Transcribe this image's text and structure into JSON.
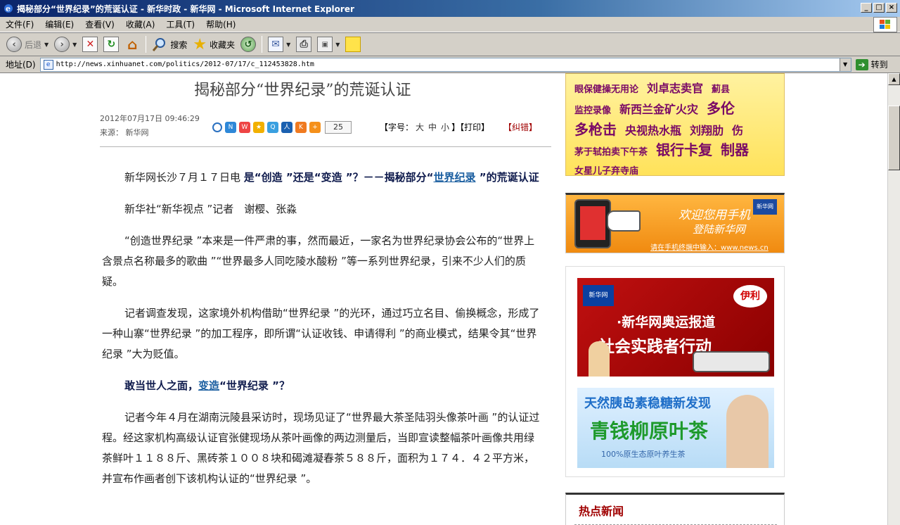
{
  "window": {
    "title": "揭秘部分“世界纪录”的荒诞认证 - 新华时政 - 新华网 - Microsoft Internet Explorer"
  },
  "menu": [
    "文件(F)",
    "编辑(E)",
    "查看(V)",
    "收藏(A)",
    "工具(T)",
    "帮助(H)"
  ],
  "toolbar": {
    "back_label": "后退",
    "search_label": "搜索",
    "favorites_label": "收藏夹"
  },
  "address": {
    "label": "地址(D)",
    "url": "http://news.xinhuanet.com/politics/2012-07/17/c_112453828.htm",
    "go_label": "转到"
  },
  "article": {
    "title": "揭秘部分“世界纪录”的荒诞认证",
    "date": "2012年07月17日 09:46:29",
    "source": "来源： 新华网",
    "share_count": "25",
    "font_ctrl": {
      "prefix": "【字号：",
      "big": "大",
      "mid": "中",
      "small": "小",
      "suffix": "】",
      "print": "【打印】"
    },
    "report": "【纠错】",
    "paragraphs": {
      "p1_lead": "新华网长沙７月１７日电 ",
      "p1_bold_a": "是“创造 ”还是“变造 ”？－－揭秘部分“",
      "p1_link": "世界纪录",
      "p1_bold_b": " ”的荒诞认证",
      "p2": "新华社“新华视点 ”记者　谢樱、张淼",
      "p3": "“创造世界纪录 ”本来是一件严肃的事，然而最近，一家名为世界纪录协会公布的“世界上含景点名称最多的歌曲 ”“世界最多人同吃陵水酸粉 ”等一系列世界纪录，引来不少人们的质疑。",
      "p4": "记者调查发现，这家境外机构借助“世界纪录 ”的光环，通过巧立名目、偷换概念，形成了一种山寨“世界纪录 ”的加工程序，即所谓“认证收钱、申请得利 ”的商业模式，结果令其“世界纪录 ”大为贬值。",
      "p5_bold_a": "敢当世人之面，",
      "p5_link": "变造",
      "p5_bold_b": "“世界纪录 ”？",
      "p6": "记者今年４月在湖南沅陵县采访时，现场见证了“世界最大茶圣陆羽头像茶叶画 ”的认证过程。经这家机构高级认证官张健现场从茶叶画像的两边测量后，当即宣读整幅茶叶画像共用绿茶鲜叶１１８８斤、黑砖茶１００８块和碣滩凝春茶５８８斤，面积为１７４．４２平方米，并宣布作画者创下该机构认证的“世界纪录 ”。"
    }
  },
  "sidebar": {
    "hotwords": [
      {
        "text": "眼保健操无用论",
        "size": "s"
      },
      {
        "text": "刘卓志卖官",
        "size": "m"
      },
      {
        "text": "薊县",
        "size": "s"
      },
      {
        "text": "监控录像",
        "size": "s"
      },
      {
        "text": "新西兰金矿火灾",
        "size": "m"
      },
      {
        "text": "多伦",
        "size": "l"
      },
      {
        "text": "多枪击",
        "size": "l"
      },
      {
        "text": "央视热水瓶",
        "size": "m"
      },
      {
        "text": "刘翔肋",
        "size": "m"
      },
      {
        "text": "伤",
        "size": "m"
      },
      {
        "text": "茅于轼拍卖下午茶",
        "size": "s"
      },
      {
        "text": "银行卡复",
        "size": "l"
      },
      {
        "text": "制器",
        "size": "l"
      },
      {
        "text": "女星儿子弃寺庙",
        "size": "s"
      }
    ],
    "mobile_ad": {
      "line1": "欢迎您用手机",
      "line2": "登陆新华网",
      "line3": "请在手机终端中输入：www.news.cn",
      "logo": "新华网"
    },
    "olympic_ad": {
      "logo": "新华网",
      "yili": "伊利",
      "line1": "·新华网奥运报道",
      "line2": "社会实践者行动"
    },
    "tea_ad": {
      "line1": "天然胰岛素稳糖新发现",
      "line2": "青钱柳原叶茶",
      "line3": "100%原生态原叶养生茶"
    },
    "hot_news_title": "热点新闻"
  }
}
